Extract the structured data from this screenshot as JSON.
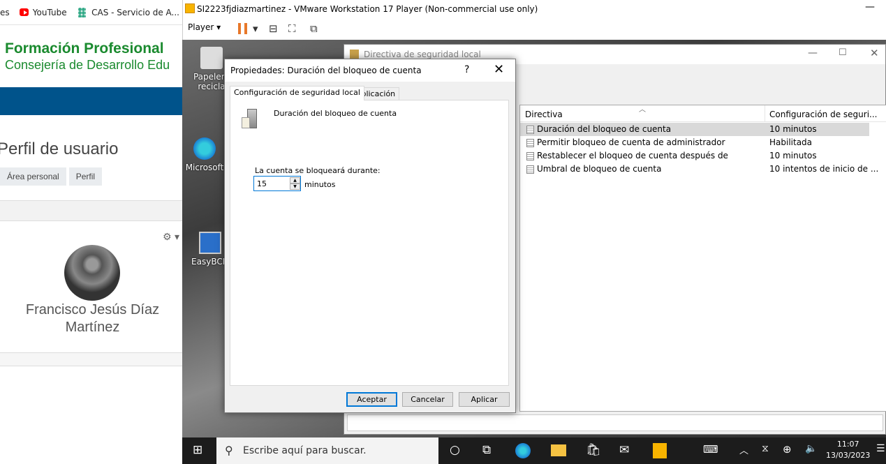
{
  "browser": {
    "bookmarks": {
      "partial": "es",
      "youtube": "YouTube",
      "cas": "CAS - Servicio de A..."
    },
    "org": {
      "line1": "Formación Profesional",
      "line2": "Consejería de Desarrollo Edu"
    },
    "page_title": "Perfil de usuario",
    "breadcrumb": [
      "Área personal",
      "Perfil"
    ],
    "gear": "⚙ ▾",
    "user_name": "Francisco Jesús Díaz Martínez"
  },
  "vmware": {
    "title": "SI2223fjdiazmartinez - VMware Workstation 17 Player (Non-commercial use only)",
    "player_menu": "Player",
    "minimize": "—"
  },
  "desktop": {
    "icons": [
      {
        "label": "Papelera\nrecicla"
      },
      {
        "label": "Microsoft"
      },
      {
        "label": "EasyBCD"
      }
    ]
  },
  "security_window": {
    "title": "Directiva de seguridad local",
    "columns": {
      "policy": "Directiva",
      "setting": "Configuración de seguri..."
    },
    "rows": [
      {
        "policy": "Duración del bloqueo de cuenta",
        "setting": "10 minutos"
      },
      {
        "policy": "Permitir bloqueo de cuenta de administrador",
        "setting": "Habilitada"
      },
      {
        "policy": "Restablecer el bloqueo de cuenta después de",
        "setting": "10 minutos"
      },
      {
        "policy": "Umbral de bloqueo de cuenta",
        "setting": "10 intentos de inicio de ..."
      }
    ]
  },
  "dialog": {
    "title": "Propiedades: Duración del bloqueo de cuenta",
    "help": "?",
    "close": "✕",
    "tabs": [
      "Configuración de seguridad local",
      "Explicación"
    ],
    "policy_name": "Duración del bloqueo de cuenta",
    "field_label": "La cuenta se bloqueará durante:",
    "field_value": "15",
    "unit": "minutos",
    "buttons": {
      "ok": "Aceptar",
      "cancel": "Cancelar",
      "apply": "Aplicar"
    }
  },
  "taskbar": {
    "search_placeholder": "Escribe aquí para buscar.",
    "time": "11:07",
    "date": "13/03/2023"
  }
}
